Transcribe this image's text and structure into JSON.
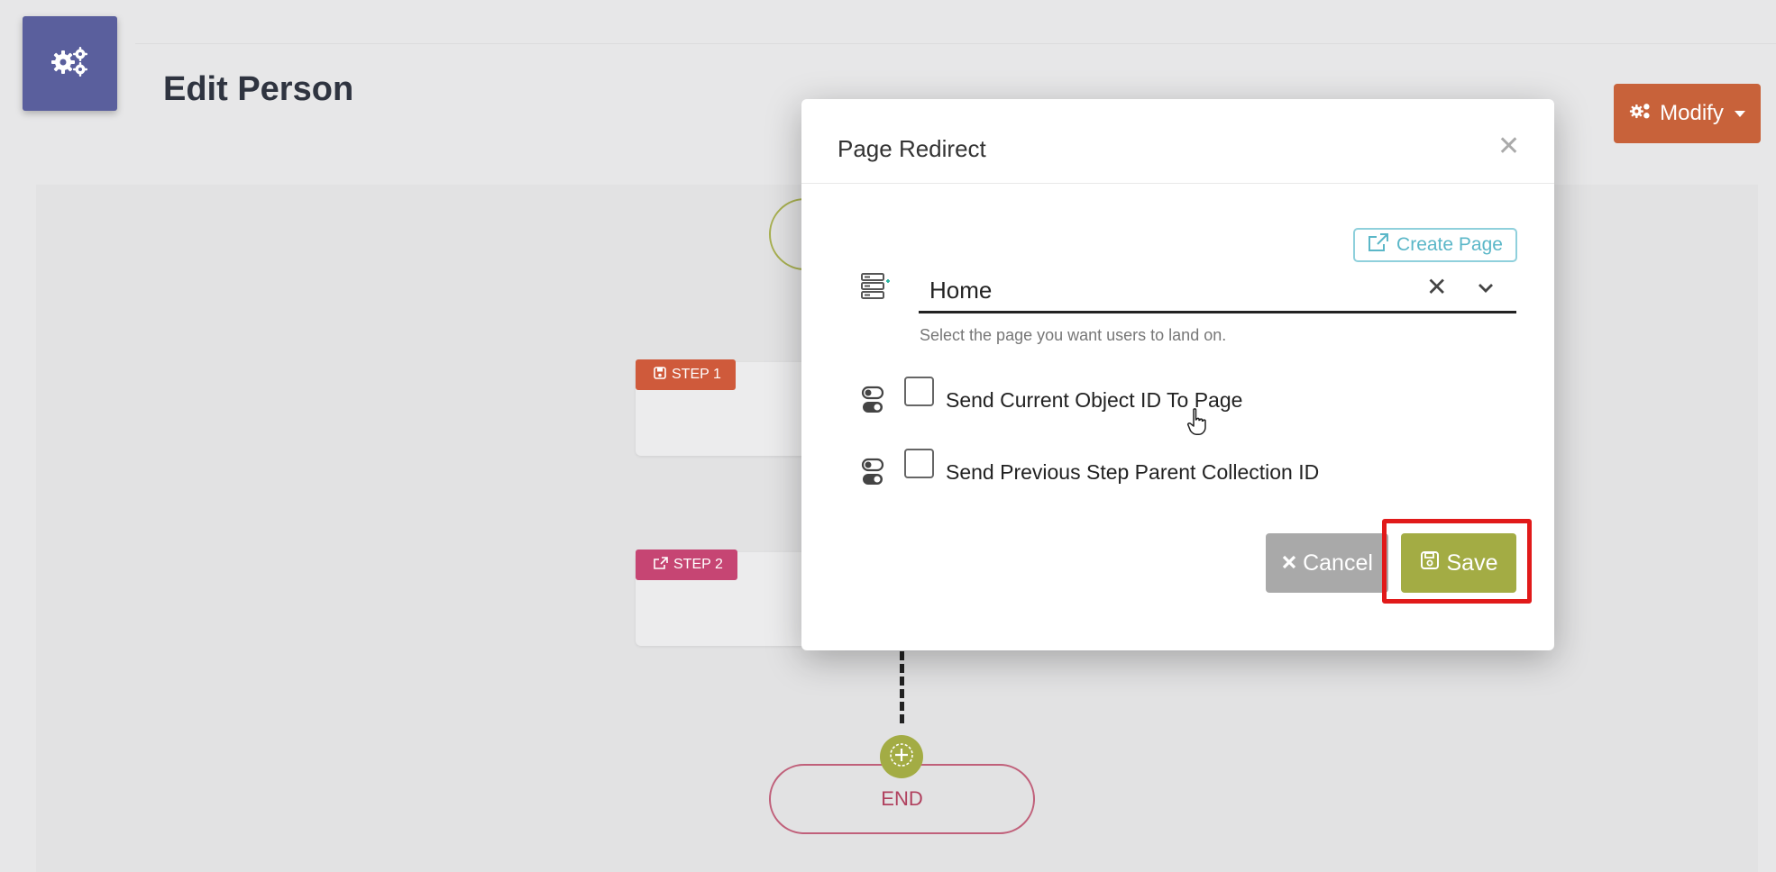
{
  "page": {
    "title": "Edit Person",
    "modify_label": "Modify"
  },
  "workflow": {
    "steps": [
      {
        "label": "STEP 1",
        "color": "#cf5a3b"
      },
      {
        "label": "STEP 2",
        "color": "#c64573"
      }
    ],
    "end_label": "END"
  },
  "modal": {
    "title": "Page Redirect",
    "create_page_label": "Create Page",
    "page_select": {
      "value": "Home",
      "helper": "Select the page you want users to land on."
    },
    "options": [
      {
        "label": "Send Current Object ID To Page",
        "checked": false
      },
      {
        "label": "Send Previous Step Parent Collection ID",
        "checked": false
      }
    ],
    "cancel_label": "Cancel",
    "save_label": "Save"
  },
  "colors": {
    "app_icon": "#5a5f9d",
    "modify": "#c8623a",
    "save": "#a3ac44",
    "cancel": "#a9a9a9",
    "create_page": "#5bb7c8",
    "highlight": "#e11a1a"
  }
}
